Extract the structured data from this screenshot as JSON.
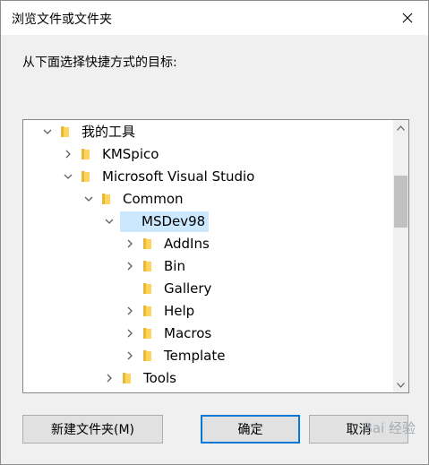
{
  "dialog": {
    "title": "浏览文件或文件夹",
    "instruction": "从下面选择快捷方式的目标:"
  },
  "tree": {
    "items": [
      {
        "label": "我的工具",
        "level": 0,
        "expander": "expanded"
      },
      {
        "label": "KMSpico",
        "level": 1,
        "expander": "collapsed"
      },
      {
        "label": "Microsoft Visual Studio",
        "level": 1,
        "expander": "expanded"
      },
      {
        "label": "Common",
        "level": 2,
        "expander": "expanded"
      },
      {
        "label": "MSDev98",
        "level": 3,
        "expander": "expanded",
        "selected": true
      },
      {
        "label": "AddIns",
        "level": 4,
        "expander": "collapsed"
      },
      {
        "label": "Bin",
        "level": 4,
        "expander": "collapsed"
      },
      {
        "label": "Gallery",
        "level": 4,
        "expander": "none"
      },
      {
        "label": "Help",
        "level": 4,
        "expander": "collapsed"
      },
      {
        "label": "Macros",
        "level": 4,
        "expander": "collapsed"
      },
      {
        "label": "Template",
        "level": 4,
        "expander": "collapsed"
      },
      {
        "label": "Tools",
        "level": 3,
        "expander": "collapsed"
      }
    ]
  },
  "buttons": {
    "new_folder": "新建文件夹(M)",
    "ok": "确定",
    "cancel": "取消"
  },
  "watermark": "Bai 经验",
  "colors": {
    "selection": "#cce8ff",
    "folder": "#ffd45c",
    "primary_border": "#0078d7"
  }
}
